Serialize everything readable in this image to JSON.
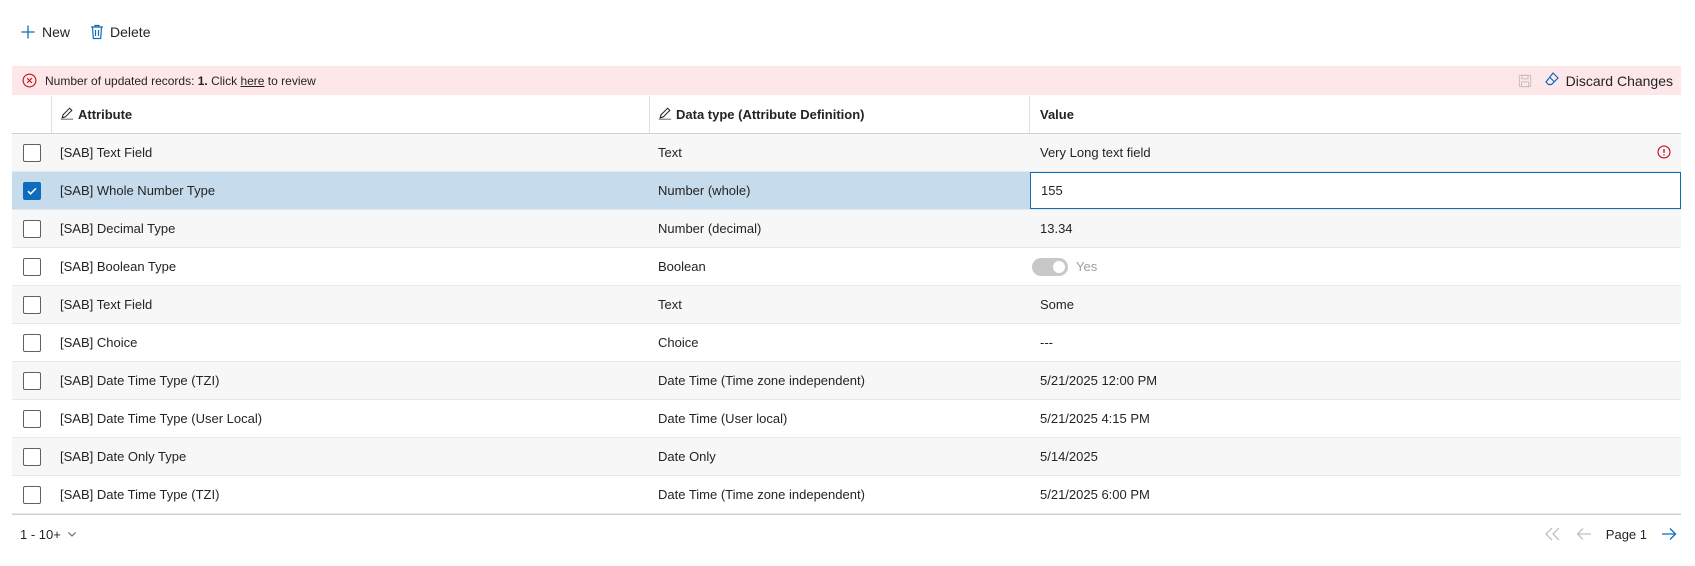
{
  "toolbar": {
    "new_label": "New",
    "delete_label": "Delete"
  },
  "banner": {
    "text_before": "Number of updated records: ",
    "count": "1.",
    "text_click": " Click ",
    "link_text": "here",
    "text_after": " to review",
    "discard_label": "Discard Changes"
  },
  "columns": {
    "attribute": "Attribute",
    "data_type": "Data type (Attribute Definition)",
    "value": "Value"
  },
  "rows": [
    {
      "attribute": "[SAB] Text Field",
      "data_type": "Text",
      "value": "Very Long text field"
    },
    {
      "attribute": "[SAB] Whole Number Type",
      "data_type": "Number (whole)",
      "value": "155"
    },
    {
      "attribute": "[SAB] Decimal Type",
      "data_type": "Number (decimal)",
      "value": "13.34"
    },
    {
      "attribute": "[SAB] Boolean Type",
      "data_type": "Boolean",
      "value": "Yes"
    },
    {
      "attribute": "[SAB] Text Field",
      "data_type": "Text",
      "value": "Some"
    },
    {
      "attribute": "[SAB] Choice",
      "data_type": "Choice",
      "value": "---"
    },
    {
      "attribute": "[SAB] Date Time Type (TZI)",
      "data_type": "Date Time (Time zone independent)",
      "value": "5/21/2025 12:00 PM"
    },
    {
      "attribute": "[SAB] Date Time Type (User Local)",
      "data_type": "Date Time (User local)",
      "value": "5/21/2025 4:15 PM"
    },
    {
      "attribute": "[SAB] Date Only Type",
      "data_type": "Date Only",
      "value": "5/14/2025"
    },
    {
      "attribute": "[SAB] Date Time Type (TZI)",
      "data_type": "Date Time (Time zone independent)",
      "value": "5/21/2025 6:00 PM"
    }
  ],
  "footer": {
    "range_label": "1 - 10+",
    "page_label": "Page 1"
  },
  "colors": {
    "accent": "#0f6cbd",
    "banner_bg": "#fde7e9",
    "error": "#c50f1f",
    "selected_row": "#c6dcec"
  }
}
